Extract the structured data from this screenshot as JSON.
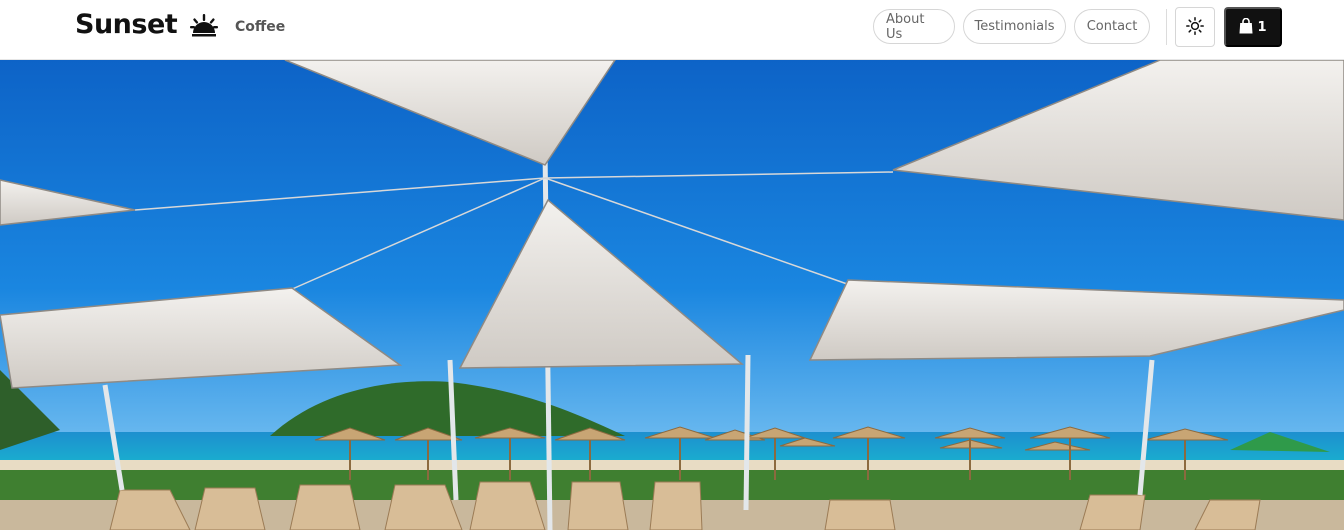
{
  "brand": {
    "name": "Sunset",
    "tagline": "Coffee",
    "logo_icon": "sunset-icon"
  },
  "nav": {
    "links": [
      {
        "label": "About Us"
      },
      {
        "label": "Testimonials"
      },
      {
        "label": "Contact"
      }
    ]
  },
  "actions": {
    "theme_icon": "sun-icon",
    "cart_icon": "shopping-bag-icon",
    "cart_count": "1"
  },
  "hero": {
    "image": "beach-shade-sails-photo"
  },
  "colors": {
    "cart_bg": "#111111",
    "sky": "#1d7fd8",
    "sea": "#1aa6c9",
    "sail": "#e9e6e1"
  }
}
